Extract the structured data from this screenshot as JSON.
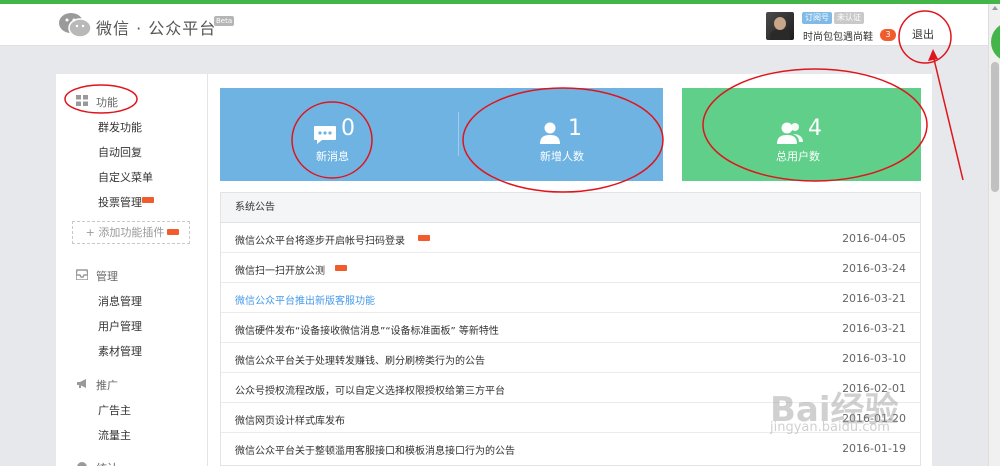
{
  "header": {
    "brand": "微信 · 公众平台",
    "beta": "Beta",
    "tag_type": "订阅号",
    "tag_verify": "未认证",
    "account_name": "时尚包包遇尚鞋",
    "unread_count": "3",
    "logout": "退出"
  },
  "sidebar": {
    "sections": [
      {
        "title": "功能",
        "icon": "grid-icon",
        "items": [
          "群发功能",
          "自动回复",
          "自定义菜单",
          "投票管理"
        ]
      },
      {
        "title": "管理",
        "icon": "inbox-icon",
        "items": [
          "消息管理",
          "用户管理",
          "素材管理"
        ]
      },
      {
        "title": "推广",
        "icon": "megaphone-icon",
        "items": [
          "广告主",
          "流量主"
        ]
      },
      {
        "title": "统计",
        "icon": "chart-icon",
        "items": []
      }
    ],
    "add_plugin": "+ 添加功能插件"
  },
  "stats": [
    {
      "value": "0",
      "label": "新消息",
      "icon": "message-icon"
    },
    {
      "value": "1",
      "label": "新增人数",
      "icon": "user-icon"
    },
    {
      "value": "4",
      "label": "总用户数",
      "icon": "users-icon"
    }
  ],
  "notices": {
    "title": "系统公告",
    "rows": [
      {
        "text": "微信公众平台将逐步开启帐号扫码登录",
        "date": "2016-04-05",
        "is_new": true,
        "link": false
      },
      {
        "text": "微信扫一扫开放公测",
        "date": "2016-03-24",
        "is_new": true,
        "link": false
      },
      {
        "text": "微信公众平台推出新版客服功能",
        "date": "2016-03-21",
        "is_new": false,
        "link": true
      },
      {
        "text": "微信硬件发布“设备接收微信消息”“设备标准面板” 等新特性",
        "date": "2016-03-21",
        "is_new": false,
        "link": false
      },
      {
        "text": "微信公众平台关于处理转发赚钱、刷分刷榜类行为的公告",
        "date": "2016-03-10",
        "is_new": false,
        "link": false
      },
      {
        "text": "公众号授权流程改版，可以自定义选择权限授权给第三方平台",
        "date": "2016-02-01",
        "is_new": false,
        "link": false
      },
      {
        "text": "微信网页设计样式库发布",
        "date": "2016-01-20",
        "is_new": false,
        "link": false
      },
      {
        "text": "微信公众平台关于整顿滥用客服接口和模板消息接口行为的公告",
        "date": "2016-01-19",
        "is_new": false,
        "link": false
      }
    ]
  },
  "watermark": {
    "line1": "Bai经验",
    "line2": "jingyan.baidu.com"
  },
  "colors": {
    "top_green": "#44b549",
    "blue_tile": "#6fb3e3",
    "green_tile": "#5fcf8a",
    "badge_red": "#f25c2d",
    "link_blue": "#459ae9",
    "annotation_red": "#e0141c"
  }
}
